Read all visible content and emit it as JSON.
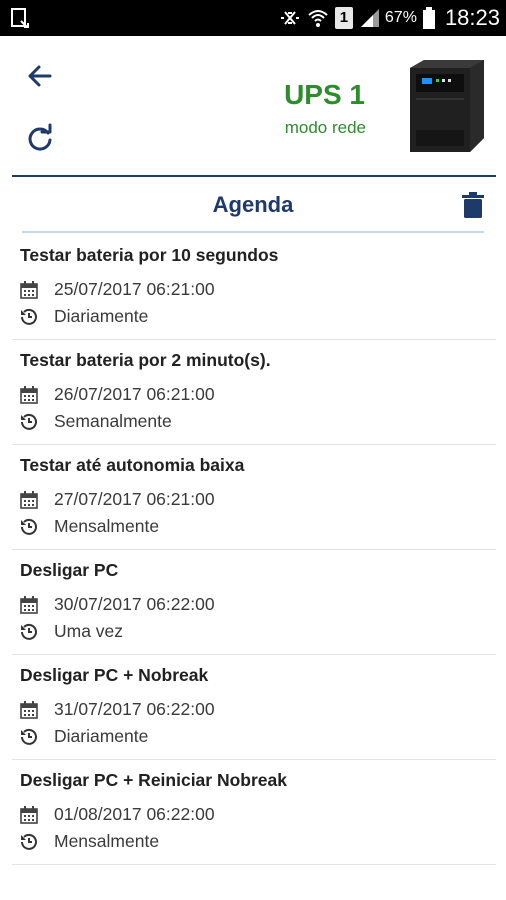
{
  "status_bar": {
    "battery_percent": "67%",
    "sim_slot": "1",
    "time": "18:23",
    "icons": [
      "screenshot-icon",
      "mute-icon",
      "wifi-icon",
      "sim-icon",
      "signal-icon",
      "battery-icon"
    ]
  },
  "header": {
    "ups_name": "UPS 1",
    "mode": "modo rede",
    "icons": {
      "back": "arrow-back-icon",
      "refresh": "refresh-icon"
    }
  },
  "section": {
    "title": "Agenda",
    "delete_icon": "trash-icon"
  },
  "schedule": [
    {
      "title": "Testar bateria por 10 segundos",
      "datetime": "25/07/2017 06:21:00",
      "repeat": "Diariamente"
    },
    {
      "title": "Testar bateria por 2 minuto(s).",
      "datetime": "26/07/2017 06:21:00",
      "repeat": "Semanalmente"
    },
    {
      "title": "Testar até autonomia baixa",
      "datetime": "27/07/2017 06:21:00",
      "repeat": "Mensalmente"
    },
    {
      "title": "Desligar PC",
      "datetime": "30/07/2017 06:22:00",
      "repeat": "Uma vez"
    },
    {
      "title": "Desligar PC + Nobreak",
      "datetime": "31/07/2017 06:22:00",
      "repeat": "Diariamente"
    },
    {
      "title": "Desligar PC + Reiniciar Nobreak",
      "datetime": "01/08/2017 06:22:00",
      "repeat": "Mensalmente"
    }
  ],
  "colors": {
    "accent_navy": "#1e3a6b",
    "status_green": "#2e8b2e",
    "statusbar_bg": "#000000"
  }
}
